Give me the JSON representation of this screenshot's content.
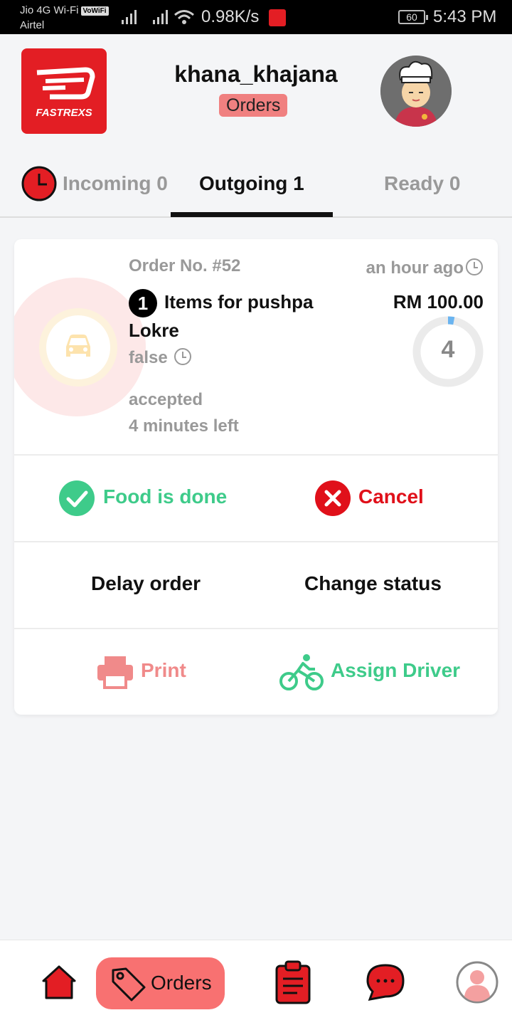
{
  "status_bar": {
    "carrier1": "Jio 4G Wi-Fi",
    "vowifi": "VoWiFi",
    "carrier2": "Airtel",
    "speed": "0.98K/s",
    "battery": "60",
    "time": "5:43 PM"
  },
  "header": {
    "logo_text": "FASTREXS",
    "shop_name": "khana_khajana",
    "section_badge": "Orders"
  },
  "tabs": [
    {
      "label": "Incoming 0",
      "active": false
    },
    {
      "label": "Outgoing 1",
      "active": true
    },
    {
      "label": "Ready 0",
      "active": false
    }
  ],
  "order": {
    "order_no": "Order No. #52",
    "time_ago": "an hour ago",
    "item_count": "1",
    "items_text": "Items for pushpa Lokre",
    "price": "RM 100.00",
    "false_text": "false",
    "timer_value": "4",
    "timer_progress": 0.03,
    "status": "accepted",
    "minutes_left": "4 minutes left"
  },
  "actions": {
    "food_done": "Food is done",
    "cancel": "Cancel",
    "delay": "Delay order",
    "change_status": "Change status",
    "print": "Print",
    "assign_driver": "Assign Driver"
  },
  "bottom_nav": {
    "orders_label": "Orders"
  },
  "colors": {
    "brand_red": "#e31e24",
    "green": "#3ecb8a",
    "cancel_red": "#e0101a",
    "print_pink": "#f08a8a",
    "nav_active": "#f87171"
  }
}
